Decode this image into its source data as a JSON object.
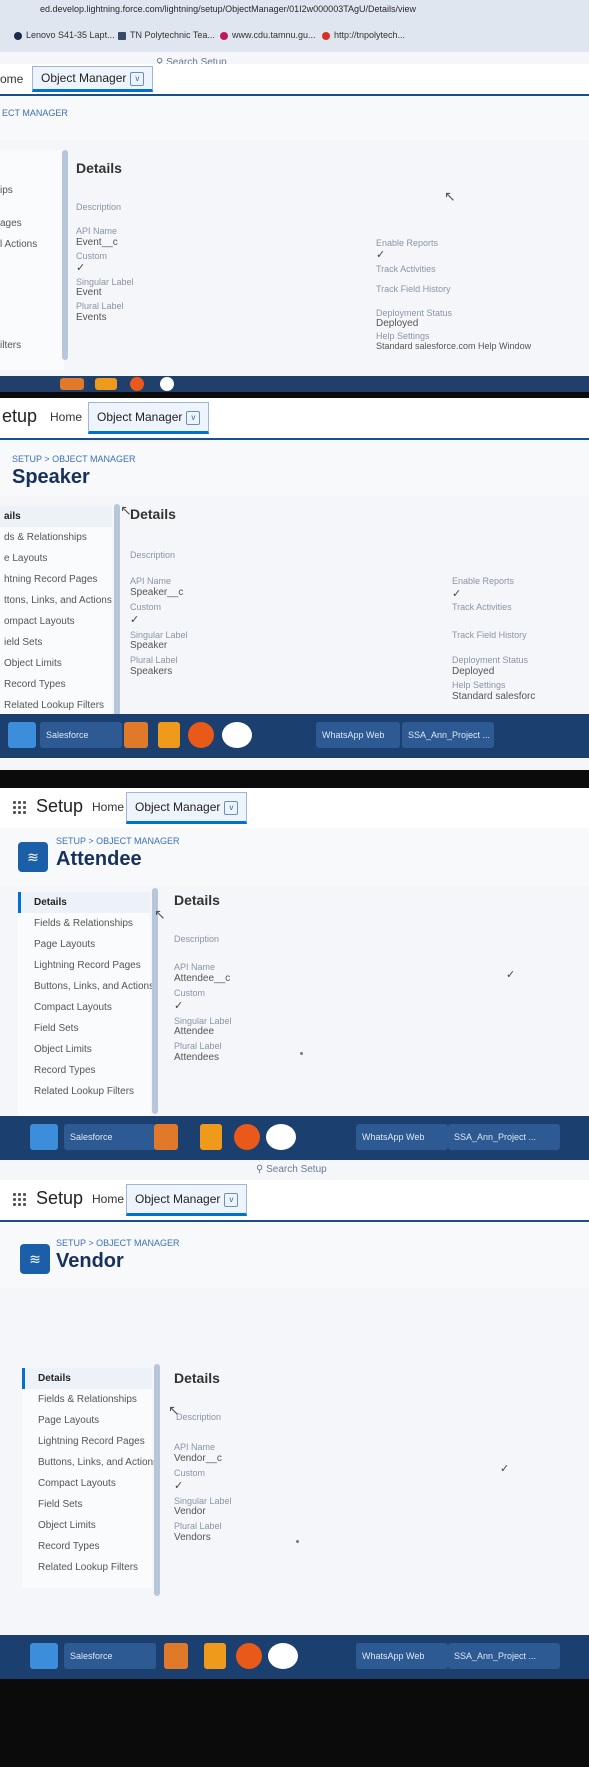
{
  "browser": {
    "url": "ed.develop.lightning.force.com/lightning/setup/ObjectManager/01I2w000003TAgU/Details/view",
    "bookmarks": [
      "Lenovo S41-35 Lapt...",
      "TN Polytechnic Tea...",
      "www.cdu.tamnu.gu...",
      "http://tnpolytech..."
    ],
    "search_placeholder": "Search Setup"
  },
  "header": {
    "app_title": "Setup",
    "home_label": "Home",
    "object_manager_label": "Object Manager",
    "dropdown_glyph": "v",
    "partial_home": "ome",
    "partial_setup": "etup"
  },
  "breadcrumb": "SETUP > OBJECT MANAGER",
  "breadcrumb_partial": "ECT MANAGER",
  "sidebar": {
    "items": [
      "Details",
      "Fields & Relationships",
      "Page Layouts",
      "Lightning Record Pages",
      "Buttons, Links, and Actions",
      "Compact Layouts",
      "Field Sets",
      "Object Limits",
      "Record Types",
      "Related Lookup Filters"
    ],
    "partial_items_1": [
      "ips",
      "ages",
      "l Actions",
      "ilters"
    ],
    "partial_items_2": [
      "ails",
      "ds & Relationships",
      "e Layouts",
      "htning Record Pages",
      "ttons, Links, and Actions",
      "ompact Layouts",
      "ield Sets",
      "Object Limits",
      "Record Types",
      "Related Lookup Filters"
    ]
  },
  "details": {
    "heading": "Details",
    "labels": {
      "description": "Description",
      "api_name": "API Name",
      "custom": "Custom",
      "singular": "Singular Label",
      "plural": "Plural Label",
      "enable_reports": "Enable Reports",
      "track_activities": "Track Activities",
      "track_field_history": "Track Field History",
      "deployment_status": "Deployment Status",
      "help_settings": "Help Settings"
    },
    "deployed": "Deployed",
    "help_value": "Standard salesforce.com Help Window",
    "help_value_partial": "Standard salesforc",
    "checkmark": "✓"
  },
  "shots": [
    {
      "object": "Event",
      "api": "Event__c",
      "singular": "Event",
      "plural": "Events"
    },
    {
      "object": "Speaker",
      "api": "Speaker__c",
      "singular": "Speaker",
      "plural": "Speakers"
    },
    {
      "object": "Attendee",
      "api": "Attendee__c",
      "singular": "Attendee",
      "plural": "Attendees"
    },
    {
      "object": "Vendor",
      "api": "Vendor__c",
      "singular": "Vendor",
      "plural": "Vendors"
    }
  ],
  "taskbar": {
    "items": [
      "Salesforce",
      "WhatsApp Web",
      "SSA_Ann_Project ..."
    ]
  },
  "colors": {
    "brand": "#0070d2",
    "header_line": "#1b4f8c",
    "taskbar": "#1b3f6e"
  }
}
